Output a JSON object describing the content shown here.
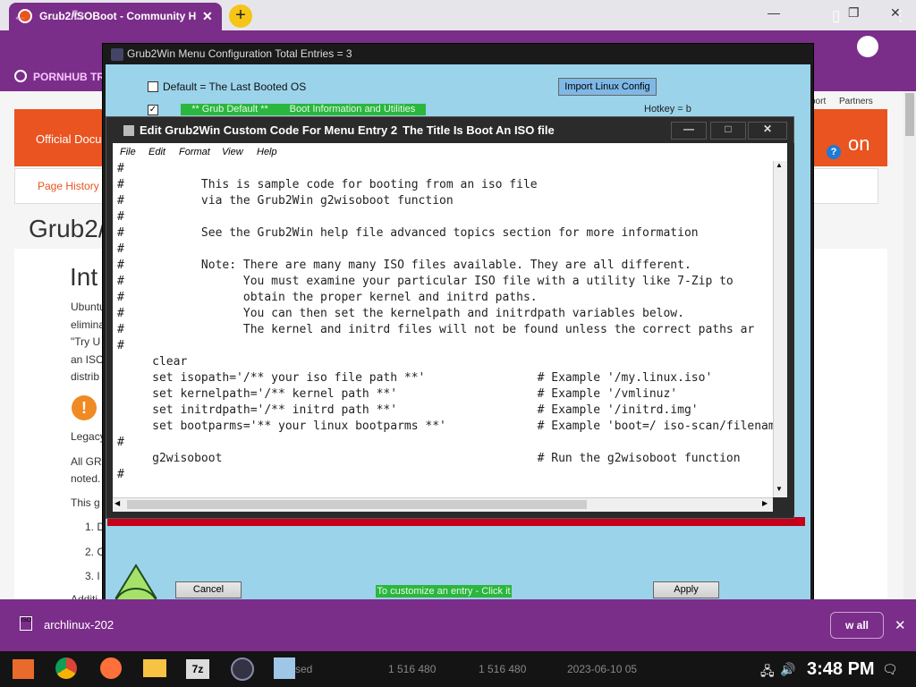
{
  "browser": {
    "tab_title": "Grub2/ISOBoot - Community H",
    "new_tab": "+",
    "bookmark": "PORNHUB TR",
    "win_min": "—",
    "win_max": "❐",
    "win_close": "✕"
  },
  "page": {
    "official": "Official Docu",
    "page_history": "Page History",
    "heading": "Grub2/",
    "intro": "Int",
    "partners": "Partners",
    "port": "port",
    "on": "on",
    "lines": [
      "Ubuntu",
      "elimina",
      "\"Try U",
      "an ISO",
      "distrib"
    ],
    "legacy": "Legacy",
    "allgrub": "All GRU",
    "noted": "noted.",
    "thisg": "This g",
    "list": [
      "1. D",
      "2. C",
      "3. I"
    ],
    "addl": "Additi"
  },
  "grub": {
    "title": "Grub2Win Menu Configuration     Total Entries = 3",
    "default_label": "Default = The Last Booted OS",
    "import_button": "Import Linux Config",
    "grub_default": "** Grub Default **",
    "boot_info": "Boot Information and Utilities",
    "hotkey": "Hotkey = b",
    "cancel": "Cancel",
    "customize": "To customize an entry - Click it",
    "apply": "Apply"
  },
  "editor": {
    "title": "Edit Grub2Win Custom Code For Menu Entry 2",
    "subtitle": "The Title Is Boot An ISO file",
    "menu": [
      "File",
      "Edit",
      "Format",
      "View",
      "Help"
    ],
    "lines": [
      "#",
      "#           This is sample code for booting from an iso file",
      "#           via the Grub2Win g2wisoboot function",
      "#",
      "#           See the Grub2Win help file advanced topics section for more information",
      "#",
      "#           Note: There are many many ISO files available. They are all different.",
      "#                 You must examine your particular ISO file with a utility like 7-Zip to",
      "#                 obtain the proper kernel and initrd paths.",
      "#                 You can then set the kernelpath and initrdpath variables below.",
      "#                 The kernel and initrd files will not be found unless the correct paths ar",
      "#",
      "     clear",
      "     set isopath='/** your iso file path **'                # Example '/my.linux.iso'",
      "     set kernelpath='/** kernel path **'                    # Example '/vmlinuz'",
      "     set initrdpath='/** initrd path **'                    # Example '/initrd.img'",
      "     set bootparms='** your linux bootparms **'             # Example 'boot=/ iso-scan/filenam",
      "#",
      "     g2wisoboot                                             # Run the g2wisoboot function",
      "#"
    ]
  },
  "bottom": {
    "download": "archlinux-202",
    "show_all": "w all"
  },
  "taskbar": {
    "file_cols": [
      "sed",
      "1 516 480",
      "1 516 480",
      "2023-06-10 05"
    ],
    "time": "3:48 PM"
  },
  "colors": {
    "purple": "#7b2d8a",
    "orange": "#e95420",
    "grub_bg": "#9bd3ea",
    "green_label": "#2bb63d"
  }
}
